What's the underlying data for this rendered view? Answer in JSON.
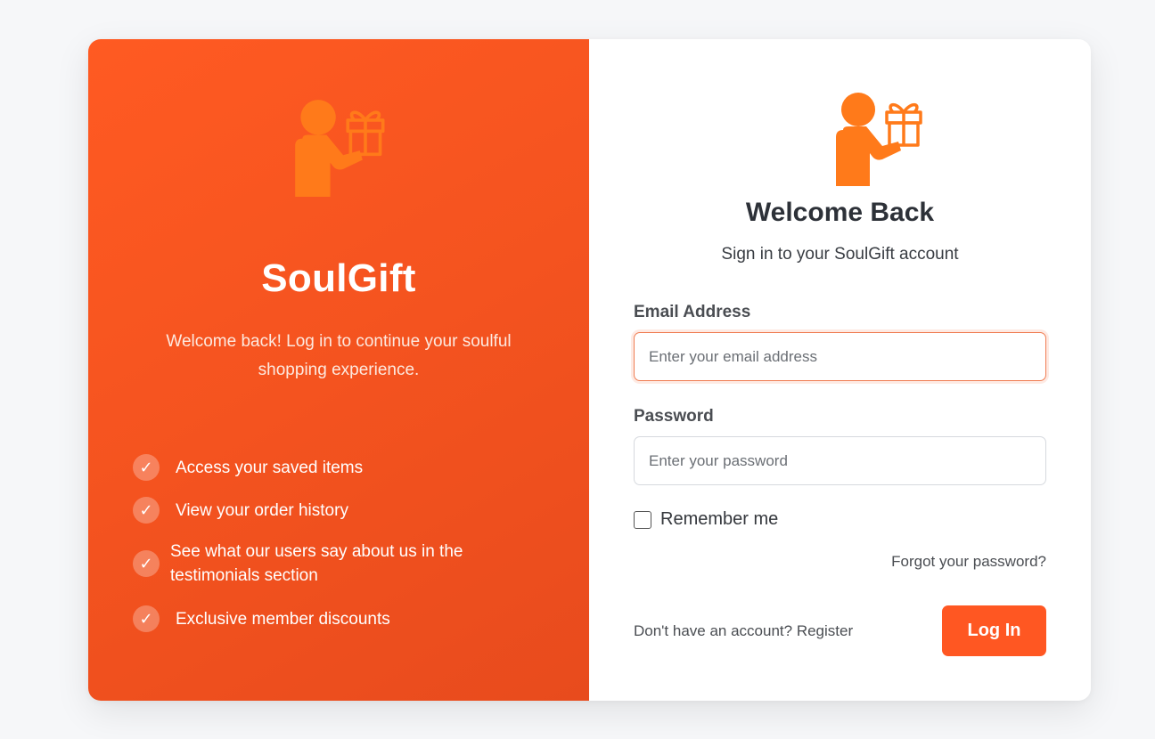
{
  "brand": {
    "name": "SoulGift",
    "tagline": "Welcome back! Log in to continue your soulful shopping experience.",
    "logo_icon": "person-gift-icon"
  },
  "features": [
    {
      "text": "Access your saved items"
    },
    {
      "text": "View your order history"
    },
    {
      "text": "See what our users say about us in the testimonials section"
    },
    {
      "text": "Exclusive member discounts"
    }
  ],
  "login": {
    "title": "Welcome Back",
    "subtitle": "Sign in to your SoulGift account",
    "email_label": "Email Address",
    "email_placeholder": "Enter your email address",
    "email_value": "",
    "password_label": "Password",
    "password_placeholder": "Enter your password",
    "password_value": "",
    "remember_label": "Remember me",
    "remember_checked": false,
    "forgot_link": "Forgot your password?",
    "register_link": "Don't have an account? Register",
    "submit_label": "Log In"
  },
  "colors": {
    "brand_orange": "#ff5722",
    "icon_orange": "#ff7a1a",
    "panel_gradient_start": "#ff5a22",
    "panel_gradient_end": "#e84b1d"
  }
}
